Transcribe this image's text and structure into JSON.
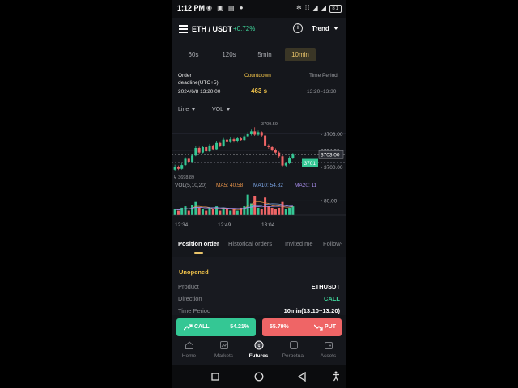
{
  "status_bar": {
    "time": "1:12 PM",
    "left_icons": [
      "notification-icon",
      "settings-icon",
      "app-icon",
      "app-icon",
      "dot-icon"
    ],
    "right_icons_text": "✻ ⁞⁞ ◢ ◢",
    "battery": "81"
  },
  "header": {
    "pair": "ETH / USDT",
    "change": "+0.72%",
    "change_color": "#3fd39a",
    "trend_label": "Trend"
  },
  "time_tabs": [
    {
      "label": "60s",
      "active": false
    },
    {
      "label": "120s",
      "active": false
    },
    {
      "label": "5min",
      "active": false
    },
    {
      "label": "10min",
      "active": true
    }
  ],
  "order_info": {
    "deadline_label_1": "Order",
    "deadline_label_2": "deadline(UTC+5)",
    "deadline_value": "2024/6/8 13:20:00",
    "countdown_label": "Countdown",
    "countdown_value": "463 s",
    "period_label": "Time Period",
    "period_value": "13:20~13:30"
  },
  "chart_controls": {
    "type_selector": "Line",
    "indicator_selector": "VOL"
  },
  "chart_data": {
    "type": "candlestick",
    "high_label": "3709.59",
    "low_label": "3698.89",
    "y_ticks": [
      "3708.00",
      "3704.00",
      "3700.00"
    ],
    "current_price_box": "3703.00",
    "marker_price": "3701",
    "y_range": [
      3698.0,
      3711.0
    ],
    "candles": [
      [
        3699.4,
        3700.1,
        3699.0,
        3700.6
      ],
      [
        3700.1,
        3699.6,
        3699.3,
        3700.4
      ],
      [
        3699.6,
        3700.5,
        3699.4,
        3700.9
      ],
      [
        3700.5,
        3702.0,
        3700.3,
        3702.4
      ],
      [
        3702.0,
        3701.2,
        3700.9,
        3702.3
      ],
      [
        3701.2,
        3702.8,
        3701.0,
        3703.2
      ],
      [
        3702.8,
        3704.6,
        3702.6,
        3705.0
      ],
      [
        3704.6,
        3703.5,
        3703.2,
        3704.9
      ],
      [
        3703.5,
        3704.8,
        3703.3,
        3705.1
      ],
      [
        3704.8,
        3703.8,
        3703.5,
        3705.0
      ],
      [
        3703.8,
        3705.2,
        3703.6,
        3705.6
      ],
      [
        3705.2,
        3704.3,
        3704.0,
        3705.4
      ],
      [
        3704.3,
        3705.8,
        3704.1,
        3706.2
      ],
      [
        3705.8,
        3705.1,
        3704.8,
        3706.0
      ],
      [
        3705.1,
        3706.6,
        3704.9,
        3707.0
      ],
      [
        3706.6,
        3706.0,
        3705.6,
        3706.9
      ],
      [
        3706.0,
        3706.7,
        3705.8,
        3707.1
      ],
      [
        3706.7,
        3706.2,
        3705.9,
        3707.0
      ],
      [
        3706.2,
        3706.9,
        3705.9,
        3707.2
      ],
      [
        3706.9,
        3706.5,
        3706.2,
        3707.3
      ],
      [
        3706.5,
        3707.4,
        3706.3,
        3707.8
      ],
      [
        3707.4,
        3707.9,
        3707.1,
        3708.4
      ],
      [
        3707.9,
        3708.6,
        3707.6,
        3709.0
      ],
      [
        3708.6,
        3707.8,
        3707.5,
        3709.59
      ],
      [
        3707.8,
        3708.4,
        3707.5,
        3708.8
      ],
      [
        3708.4,
        3707.6,
        3707.2,
        3708.6
      ],
      [
        3707.6,
        3705.2,
        3704.9,
        3707.8
      ],
      [
        3705.2,
        3704.8,
        3704.4,
        3705.5
      ],
      [
        3704.8,
        3704.2,
        3703.8,
        3705.0
      ],
      [
        3704.2,
        3703.5,
        3703.1,
        3704.5
      ],
      [
        3703.5,
        3702.6,
        3702.2,
        3703.8
      ],
      [
        3702.6,
        3700.4,
        3700.0,
        3702.9
      ],
      [
        3700.4,
        3700.9,
        3700.1,
        3701.3
      ],
      [
        3700.9,
        3702.2,
        3700.7,
        3702.6
      ],
      [
        3702.2,
        3703.0,
        3701.9,
        3703.4
      ]
    ],
    "volume": [
      4,
      3,
      5,
      6,
      3,
      7,
      9,
      5,
      4,
      3,
      5,
      4,
      6,
      3,
      5,
      4,
      3,
      4,
      3,
      5,
      6,
      14,
      8,
      13,
      5,
      4,
      12,
      6,
      5,
      4,
      5,
      9,
      4,
      5,
      6
    ],
    "vol_legend": {
      "label": "VOL(5,10,20)",
      "ma5": "MA5: 40.58",
      "ma10": "MA10: 54.82",
      "ma20": "MA20: 11"
    },
    "vol_tick": "80.00",
    "x_ticks": [
      "12:34",
      "12:49",
      "13:04"
    ],
    "up_color": "#34c794",
    "down_color": "#ef6566"
  },
  "position_tabs": [
    {
      "label": "Position order",
      "active": true
    },
    {
      "label": "Historical orders",
      "active": false
    },
    {
      "label": "Invited me",
      "active": false
    },
    {
      "label": "Follow-",
      "active": false
    }
  ],
  "order_details": {
    "status": "Unopened",
    "rows": [
      {
        "key": "Product",
        "value": "ETHUSDT"
      },
      {
        "key": "Direction",
        "value": "CALL"
      },
      {
        "key": "Time Period",
        "value": "10min(13:10~13:20)"
      }
    ]
  },
  "actions": {
    "call_label": "CALL",
    "call_percent": "54.21%",
    "put_percent": "55.79%",
    "put_label": "PUT"
  },
  "bottom_nav": [
    {
      "label": "Home",
      "icon": "home-icon",
      "active": false
    },
    {
      "label": "Markets",
      "icon": "markets-icon",
      "active": false
    },
    {
      "label": "Futures",
      "icon": "futures-icon",
      "active": true
    },
    {
      "label": "Perpetual",
      "icon": "perpetual-icon",
      "active": false
    },
    {
      "label": "Assets",
      "icon": "assets-icon",
      "active": false
    }
  ]
}
